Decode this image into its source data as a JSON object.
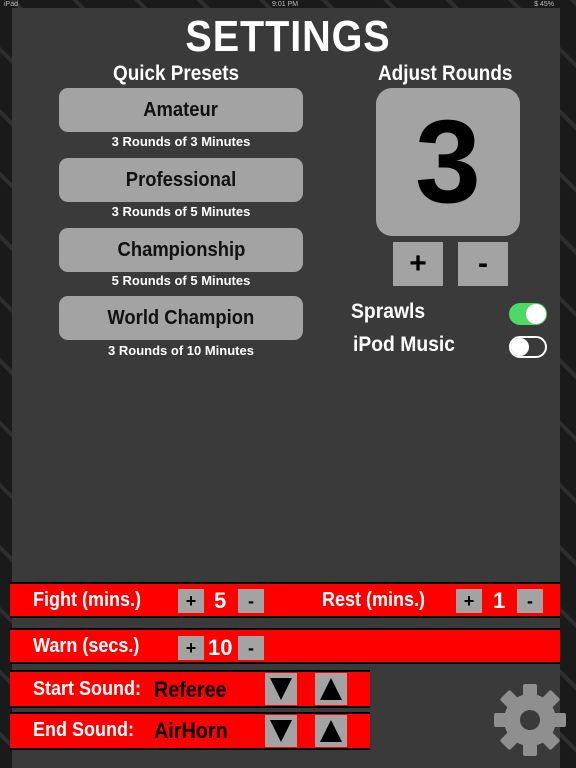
{
  "status_bar": {
    "carrier": "iPad",
    "time": "9:01 PM",
    "battery": "$ 45%"
  },
  "title": "SETTINGS",
  "presets": {
    "header": "Quick Presets",
    "items": [
      {
        "label": "Amateur",
        "description": "3 Rounds of 3 Minutes"
      },
      {
        "label": "Professional",
        "description": "3 Rounds of 5 Minutes"
      },
      {
        "label": "Championship",
        "description": "5 Rounds of 5 Minutes"
      },
      {
        "label": "World Champion",
        "description": "3 Rounds of 10 Minutes"
      }
    ]
  },
  "rounds": {
    "header": "Adjust Rounds",
    "value": "3",
    "plus": "+",
    "minus": "-"
  },
  "toggles": {
    "sprawls": {
      "label": "Sprawls",
      "on": true
    },
    "ipod_music": {
      "label": "iPod Music",
      "on": false
    }
  },
  "timing": {
    "fight": {
      "label": "Fight (mins.)",
      "value": "5"
    },
    "rest": {
      "label": "Rest (mins.)",
      "value": "1"
    },
    "warn": {
      "label": "Warn (secs.)",
      "value": "10"
    },
    "plus": "+",
    "minus": "-"
  },
  "sounds": {
    "start": {
      "label": "Start Sound:",
      "value": "Referee"
    },
    "end": {
      "label": "End Sound:",
      "value": "AirHorn"
    }
  },
  "icons": {
    "settings": "gear-icon",
    "previous": "arrow-down-icon",
    "next": "arrow-up-icon"
  },
  "colors": {
    "accent_red": "#ff0000",
    "toggle_on": "#4cd964",
    "button_gray": "#a3a3a3",
    "panel": "#3a3a3a"
  }
}
